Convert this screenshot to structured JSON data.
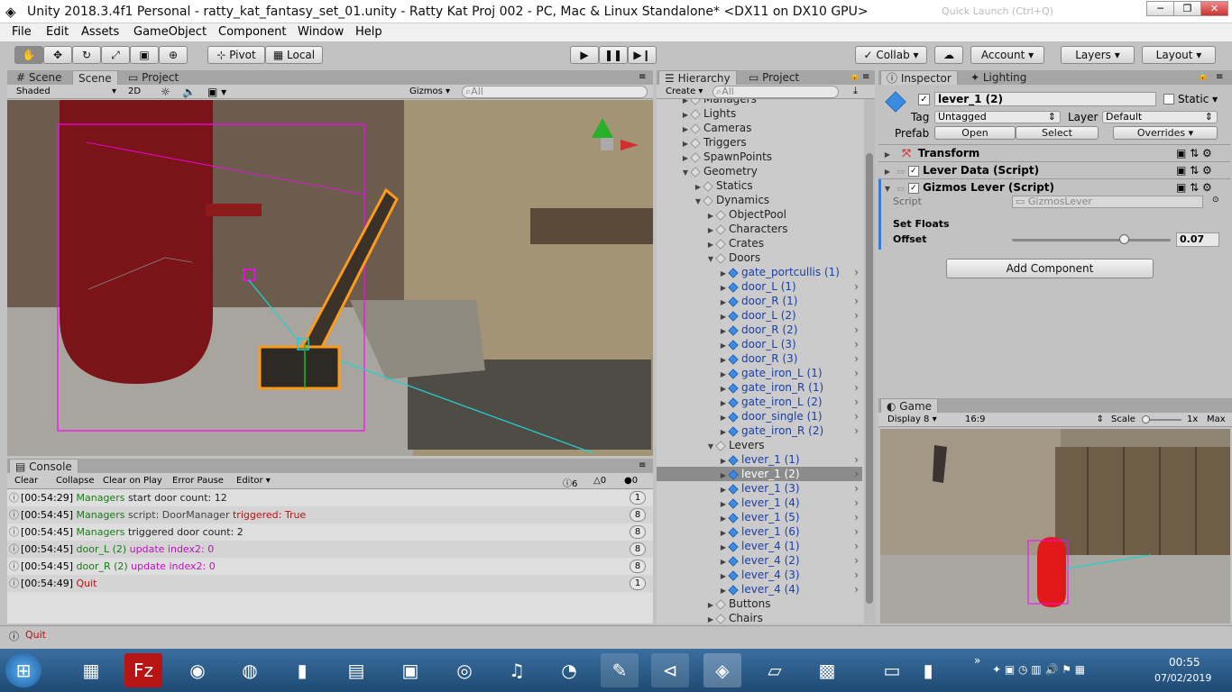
{
  "window": {
    "title": "Unity 2018.3.4f1 Personal - ratty_kat_fantasy_set_01.unity - Ratty Kat Proj 002 - PC, Mac & Linux Standalone* <DX11 on DX10 GPU>",
    "search_placeholder": "Quick Launch (Ctrl+Q)"
  },
  "menu": [
    "File",
    "Edit",
    "Assets",
    "GameObject",
    "Component",
    "Window",
    "Help"
  ],
  "toolbar": {
    "pivot": "Pivot",
    "local": "Local",
    "collab": "Collab",
    "account": "Account",
    "layers": "Layers",
    "layout": "Layout"
  },
  "scene": {
    "tabs": [
      "Scene",
      "Scene",
      "Project"
    ],
    "shading": "Shaded",
    "mode2d": "2D",
    "gizmos": "Gizmos",
    "search": "All"
  },
  "hierarchy": {
    "tabs": [
      "Hierarchy",
      "Project"
    ],
    "create": "Create",
    "search": "All",
    "rows": [
      {
        "label": "Managers",
        "indent": 1,
        "blue": false,
        "arrow": "▶"
      },
      {
        "label": "Lights",
        "indent": 1,
        "blue": false,
        "arrow": "▶"
      },
      {
        "label": "Cameras",
        "indent": 1,
        "blue": false,
        "arrow": "▶"
      },
      {
        "label": "Triggers",
        "indent": 1,
        "blue": false,
        "arrow": "▶"
      },
      {
        "label": "SpawnPoints",
        "indent": 1,
        "blue": false,
        "arrow": "▶"
      },
      {
        "label": "Geometry",
        "indent": 1,
        "blue": false,
        "arrow": "▼"
      },
      {
        "label": "Statics",
        "indent": 2,
        "blue": false,
        "arrow": "▶"
      },
      {
        "label": "Dynamics",
        "indent": 2,
        "blue": false,
        "arrow": "▼"
      },
      {
        "label": "ObjectPool",
        "indent": 3,
        "blue": false,
        "arrow": "▶"
      },
      {
        "label": "Characters",
        "indent": 3,
        "blue": false,
        "arrow": "▶"
      },
      {
        "label": "Crates",
        "indent": 3,
        "blue": false,
        "arrow": "▶"
      },
      {
        "label": "Doors",
        "indent": 3,
        "blue": false,
        "arrow": "▼"
      },
      {
        "label": "gate_portcullis (1)",
        "indent": 4,
        "blue": true,
        "arrow": "▶"
      },
      {
        "label": "door_L (1)",
        "indent": 4,
        "blue": true,
        "arrow": "▶"
      },
      {
        "label": "door_R (1)",
        "indent": 4,
        "blue": true,
        "arrow": "▶"
      },
      {
        "label": "door_L (2)",
        "indent": 4,
        "blue": true,
        "arrow": "▶"
      },
      {
        "label": "door_R (2)",
        "indent": 4,
        "blue": true,
        "arrow": "▶"
      },
      {
        "label": "door_L (3)",
        "indent": 4,
        "blue": true,
        "arrow": "▶"
      },
      {
        "label": "door_R (3)",
        "indent": 4,
        "blue": true,
        "arrow": "▶"
      },
      {
        "label": "gate_iron_L (1)",
        "indent": 4,
        "blue": true,
        "arrow": "▶"
      },
      {
        "label": "gate_iron_R (1)",
        "indent": 4,
        "blue": true,
        "arrow": "▶"
      },
      {
        "label": "gate_iron_L (2)",
        "indent": 4,
        "blue": true,
        "arrow": "▶"
      },
      {
        "label": "door_single (1)",
        "indent": 4,
        "blue": true,
        "arrow": "▶"
      },
      {
        "label": "gate_iron_R (2)",
        "indent": 4,
        "blue": true,
        "arrow": "▶"
      },
      {
        "label": "Levers",
        "indent": 3,
        "blue": false,
        "arrow": "▼"
      },
      {
        "label": "lever_1 (1)",
        "indent": 4,
        "blue": true,
        "arrow": "▶"
      },
      {
        "label": "lever_1 (2)",
        "indent": 4,
        "blue": true,
        "arrow": "▶",
        "selected": true
      },
      {
        "label": "lever_1 (3)",
        "indent": 4,
        "blue": true,
        "arrow": "▶"
      },
      {
        "label": "lever_1 (4)",
        "indent": 4,
        "blue": true,
        "arrow": "▶"
      },
      {
        "label": "lever_1 (5)",
        "indent": 4,
        "blue": true,
        "arrow": "▶"
      },
      {
        "label": "lever_1 (6)",
        "indent": 4,
        "blue": true,
        "arrow": "▶"
      },
      {
        "label": "lever_4 (1)",
        "indent": 4,
        "blue": true,
        "arrow": "▶"
      },
      {
        "label": "lever_4 (2)",
        "indent": 4,
        "blue": true,
        "arrow": "▶"
      },
      {
        "label": "lever_4 (3)",
        "indent": 4,
        "blue": true,
        "arrow": "▶"
      },
      {
        "label": "lever_4 (4)",
        "indent": 4,
        "blue": true,
        "arrow": "▶"
      },
      {
        "label": "Buttons",
        "indent": 3,
        "blue": false,
        "arrow": "▶"
      },
      {
        "label": "Chairs",
        "indent": 3,
        "blue": false,
        "arrow": "▶"
      }
    ]
  },
  "console": {
    "tab": "Console",
    "buttons": [
      "Clear",
      "Collapse",
      "Clear on Play",
      "Error Pause",
      "Editor"
    ],
    "counts": {
      "log": "6",
      "warn": "0",
      "error": "0"
    },
    "rows": [
      {
        "time": "[00:54:29]",
        "parts": [
          {
            "t": "Managers",
            "c": "#1a7a1a"
          },
          {
            "t": " start door count: 12",
            "c": "#222"
          }
        ],
        "count": "1"
      },
      {
        "time": "[00:54:45]",
        "parts": [
          {
            "t": "Managers",
            "c": "#1a7a1a"
          },
          {
            "t": " script: DoorManager",
            "c": "#444"
          },
          {
            "t": " triggered: True",
            "c": "#c01010"
          }
        ],
        "count": "8"
      },
      {
        "time": "[00:54:45]",
        "parts": [
          {
            "t": "Managers",
            "c": "#1a7a1a"
          },
          {
            "t": " triggered door count: 2",
            "c": "#222"
          }
        ],
        "count": "8"
      },
      {
        "time": "[00:54:45]",
        "parts": [
          {
            "t": "door_L (2)",
            "c": "#1a7a1a"
          },
          {
            "t": " update index2: 0",
            "c": "#c010c0"
          }
        ],
        "count": "8"
      },
      {
        "time": "[00:54:45]",
        "parts": [
          {
            "t": "door_R (2)",
            "c": "#1a7a1a"
          },
          {
            "t": " update index2: 0",
            "c": "#c010c0"
          }
        ],
        "count": "8"
      },
      {
        "time": "[00:54:49]",
        "parts": [
          {
            "t": "Quit",
            "c": "#c01010"
          }
        ],
        "count": "1"
      }
    ]
  },
  "status": {
    "message": "Quit"
  },
  "inspector": {
    "tabs": [
      "Inspector",
      "Lighting"
    ],
    "name": "lever_1 (2)",
    "static": "Static",
    "tag_label": "Tag",
    "tag": "Untagged",
    "layer_label": "Layer",
    "layer": "Default",
    "prefab_label": "Prefab",
    "open": "Open",
    "select": "Select",
    "overrides": "Overrides",
    "components": [
      "Transform",
      "Lever Data (Script)",
      "Gizmos Lever (Script)"
    ],
    "script_label": "Script",
    "script_value": "GizmosLever",
    "set_floats": "Set Floats",
    "offset_label": "Offset",
    "offset_value": "0.07",
    "add_component": "Add Component"
  },
  "game": {
    "tab": "Game",
    "display": "Display 8",
    "aspect": "16:9",
    "scale_label": "Scale",
    "scale_value": "1x",
    "max": "Max"
  },
  "taskbar": {
    "time": "00:55",
    "date": "07/02/2019"
  },
  "colors": {
    "selected": "#8c8c8c",
    "blue_text": "#1a3fa6",
    "selection_orange": "#ff9a1a",
    "gizmo_magenta": "#ff00ff",
    "gizmo_cyan": "#22d0d0"
  }
}
